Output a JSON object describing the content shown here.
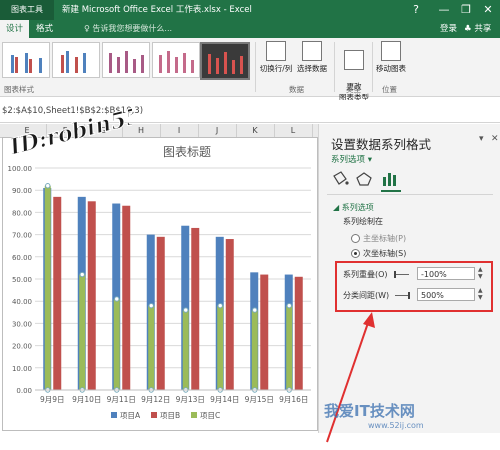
{
  "titlebar": {
    "context_tab": "图表工具",
    "title": "新建 Microsoft Office Excel 工作表.xlsx - Excel",
    "min": "—",
    "restore": "❐",
    "close": "✕",
    "help": "?"
  },
  "tabs": {
    "design": "设计",
    "format": "格式",
    "search_placeholder": "♀ 告诉我您想要做什么...",
    "login": "登录",
    "share": "♣ 共享"
  },
  "ribbon": {
    "styles_group": "图表样式",
    "switch_row_col": "切换行/列",
    "select_data": "选择数据",
    "data_group": "数据",
    "change_type": "更改\n图表类型",
    "type_group": "类型",
    "move_chart": "移动图表",
    "location_group": "位置"
  },
  "formula_bar": {
    "text": "$2:$A$10,Sheet1!$B$2:$B$10,3)"
  },
  "columns": [
    "E",
    "F",
    "G",
    "H",
    "I",
    "J",
    "K",
    "L"
  ],
  "watermark": {
    "top_left": "ID:robin553",
    "bottom_right": "我爱IT技术网",
    "url": "www.52ij.com"
  },
  "chart_data": {
    "type": "bar",
    "title": "图表标题",
    "categories": [
      "9月9日",
      "9月10日",
      "9月11日",
      "9月12日",
      "9月13日",
      "9月14日",
      "9月15日",
      "9月16日"
    ],
    "series": [
      {
        "name": "项目A",
        "color": "#4f81bd",
        "values": [
          91,
          87,
          84,
          70,
          74,
          69,
          53,
          52
        ]
      },
      {
        "name": "项目B",
        "color": "#c0504d",
        "values": [
          87,
          85,
          83,
          69,
          73,
          68,
          52,
          51
        ]
      },
      {
        "name": "项目C",
        "color": "#9bbb59",
        "values": [
          92,
          52,
          41,
          38,
          36,
          38,
          36,
          38
        ]
      }
    ],
    "y_ticks": [
      "0.00",
      "10.00",
      "20.00",
      "30.00",
      "40.00",
      "50.00",
      "60.00",
      "70.00",
      "80.00",
      "90.00",
      "100.00"
    ],
    "ylim": [
      0,
      100
    ],
    "legend": "bottom",
    "grid": true
  },
  "pane": {
    "title": "设置数据系列格式",
    "subtitle": "系列选项 ▾",
    "section": "◢ 系列选项",
    "plot_on": "系列绘制在",
    "primary": "主坐标轴(P)",
    "secondary": "次坐标轴(S)",
    "overlap_label": "系列重叠(O)",
    "overlap_value": "-100%",
    "gap_label": "分类间距(W)",
    "gap_value": "500%",
    "close": "✕",
    "pin": "▾"
  }
}
